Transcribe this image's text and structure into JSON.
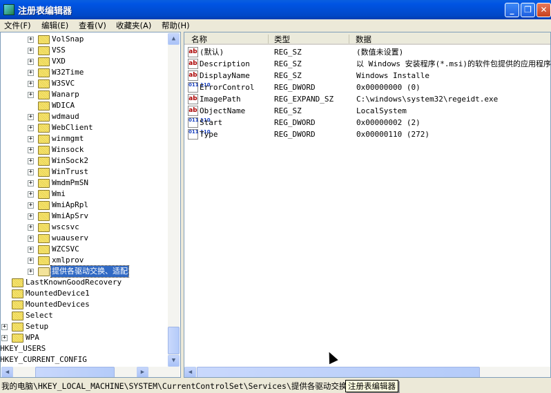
{
  "window": {
    "title": "注册表编辑器",
    "minimize": "_",
    "maximize": "❐",
    "close": "✕"
  },
  "menu": [
    {
      "label": "文件(F)"
    },
    {
      "label": "编辑(E)"
    },
    {
      "label": "查看(V)"
    },
    {
      "label": "收藏夹(A)"
    },
    {
      "label": "帮助(H)"
    }
  ],
  "tree": [
    {
      "label": "VolSnap",
      "depth": 3,
      "expandable": true
    },
    {
      "label": "VSS",
      "depth": 3,
      "expandable": true
    },
    {
      "label": "VXD",
      "depth": 3,
      "expandable": true
    },
    {
      "label": "W32Time",
      "depth": 3,
      "expandable": true
    },
    {
      "label": "W3SVC",
      "depth": 3,
      "expandable": true
    },
    {
      "label": "Wanarp",
      "depth": 3,
      "expandable": true
    },
    {
      "label": "WDICA",
      "depth": 3,
      "expandable": false
    },
    {
      "label": "wdmaud",
      "depth": 3,
      "expandable": true
    },
    {
      "label": "WebClient",
      "depth": 3,
      "expandable": true
    },
    {
      "label": "winmgmt",
      "depth": 3,
      "expandable": true
    },
    {
      "label": "Winsock",
      "depth": 3,
      "expandable": true
    },
    {
      "label": "WinSock2",
      "depth": 3,
      "expandable": true
    },
    {
      "label": "WinTrust",
      "depth": 3,
      "expandable": true
    },
    {
      "label": "WmdmPmSN",
      "depth": 3,
      "expandable": true
    },
    {
      "label": "Wmi",
      "depth": 3,
      "expandable": true
    },
    {
      "label": "WmiApRpl",
      "depth": 3,
      "expandable": true
    },
    {
      "label": "WmiApSrv",
      "depth": 3,
      "expandable": true
    },
    {
      "label": "wscsvc",
      "depth": 3,
      "expandable": true
    },
    {
      "label": "wuauserv",
      "depth": 3,
      "expandable": true
    },
    {
      "label": "WZCSVC",
      "depth": 3,
      "expandable": true
    },
    {
      "label": "xmlprov",
      "depth": 3,
      "expandable": true
    },
    {
      "label": "提供各驱动交换、适配",
      "depth": 3,
      "expandable": true,
      "selected": true
    },
    {
      "label": "LastKnownGoodRecovery",
      "depth": 2,
      "expandable": false
    },
    {
      "label": "MountedDevice1",
      "depth": 2,
      "expandable": false
    },
    {
      "label": "MountedDevices",
      "depth": 2,
      "expandable": false
    },
    {
      "label": "Select",
      "depth": 2,
      "expandable": false
    },
    {
      "label": "Setup",
      "depth": 2,
      "expandable": true
    },
    {
      "label": "WPA",
      "depth": 2,
      "expandable": true
    },
    {
      "label": "HKEY_USERS",
      "depth": 1,
      "expandable": false
    },
    {
      "label": "HKEY_CURRENT_CONFIG",
      "depth": 1,
      "expandable": false
    }
  ],
  "columns": {
    "name": "名称",
    "type": "类型",
    "data": "数据"
  },
  "values": [
    {
      "name": "(默认)",
      "type": "REG_SZ",
      "data": "(数值未设置)",
      "icon": "string"
    },
    {
      "name": "Description",
      "type": "REG_SZ",
      "data": "以 Windows 安装程序(*.msi)的软件包提供的应用程序",
      "icon": "string"
    },
    {
      "name": "DisplayName",
      "type": "REG_SZ",
      "data": "Windows Installe",
      "icon": "string"
    },
    {
      "name": "ErrorControl",
      "type": "REG_DWORD",
      "data": "0x00000000 (0)",
      "icon": "binary"
    },
    {
      "name": "ImagePath",
      "type": "REG_EXPAND_SZ",
      "data": "C:\\windows\\system32\\regeidt.exe",
      "icon": "string"
    },
    {
      "name": "ObjectName",
      "type": "REG_SZ",
      "data": "LocalSystem",
      "icon": "string"
    },
    {
      "name": "Start",
      "type": "REG_DWORD",
      "data": "0x00000002 (2)",
      "icon": "binary"
    },
    {
      "name": "Type",
      "type": "REG_DWORD",
      "data": "0x00000110 (272)",
      "icon": "binary"
    }
  ],
  "status": {
    "path": "我的电脑\\HKEY_LOCAL_MACHINE\\SYSTEM\\CurrentControlSet\\Services\\提供各驱动交换、适配",
    "tooltip": "注册表编辑器"
  }
}
